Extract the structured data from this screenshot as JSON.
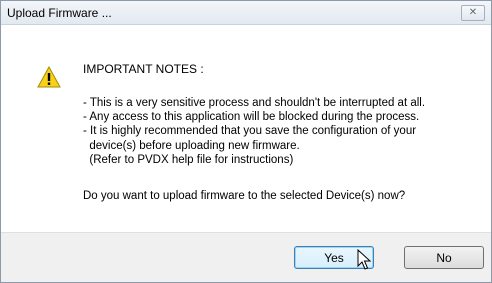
{
  "window": {
    "title": "Upload Firmware ...",
    "close_label": "✕"
  },
  "message": {
    "icon": "warning-icon",
    "heading": "IMPORTANT NOTES :",
    "notes": [
      "- This is a very sensitive process and shouldn't be interrupted at all.",
      "- Any access to this application will be blocked during the process.",
      "- It is highly recommended that you save the configuration of your",
      "  device(s) before uploading new firmware.",
      "  (Refer to PVDX help file for instructions)"
    ],
    "question": "Do you want to upload firmware to the selected Device(s) now?"
  },
  "buttons": {
    "yes_label": "Yes",
    "no_label": "No"
  },
  "colors": {
    "warning_fill": "#f7d21b",
    "warning_border": "#a88a00",
    "focus_border": "#3c7fb1"
  }
}
